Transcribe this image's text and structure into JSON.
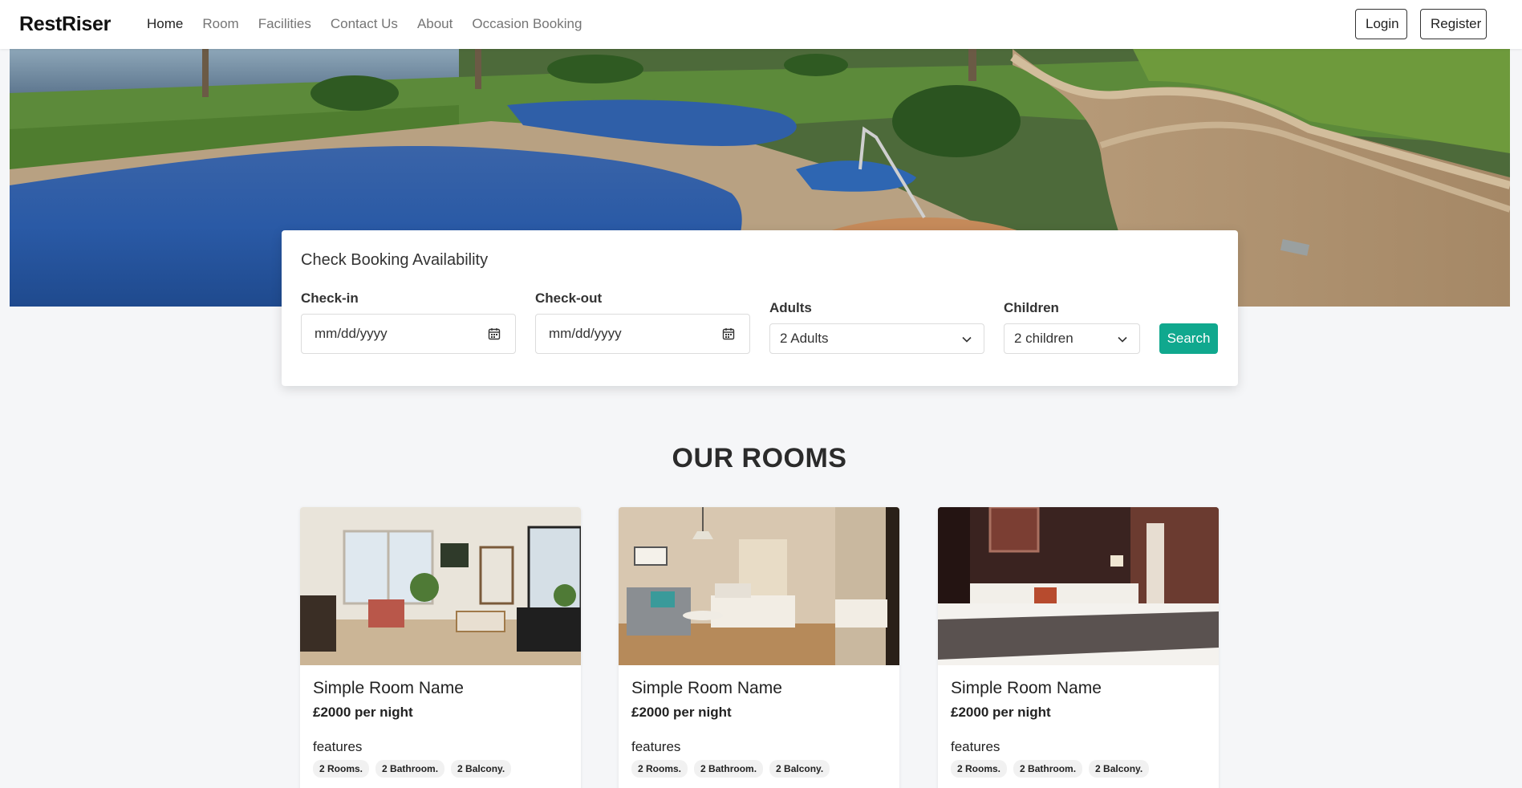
{
  "brand": "RestRiser",
  "nav": {
    "links": [
      "Home",
      "Room",
      "Facilities",
      "Contact Us",
      "About",
      "Occasion Booking"
    ],
    "login_label": "Login",
    "register_label": "Register"
  },
  "booking": {
    "title": "Check Booking Availability",
    "checkin_label": "Check-in",
    "checkin_placeholder": "mm/dd/yyyy",
    "checkout_label": "Check-out",
    "checkout_placeholder": "mm/dd/yyyy",
    "adults_label": "Adults",
    "adults_value": "2 Adults",
    "children_label": "Children",
    "children_value": "2 children",
    "search_label": "Search"
  },
  "rooms": {
    "title": "OUR ROOMS",
    "items": [
      {
        "name": "Simple Room Name",
        "price": "£2000 per night",
        "features_label": "features",
        "features": [
          "2 Rooms.",
          "2 Bathroom.",
          "2 Balcony."
        ]
      },
      {
        "name": "Simple Room Name",
        "price": "£2000 per night",
        "features_label": "features",
        "features": [
          "2 Rooms.",
          "2 Bathroom.",
          "2 Balcony."
        ]
      },
      {
        "name": "Simple Room Name",
        "price": "£2000 per night",
        "features_label": "features",
        "features": [
          "2 Rooms.",
          "2 Bathroom.",
          "2 Balcony."
        ]
      }
    ]
  },
  "colors": {
    "accent": "#10a88e",
    "page_bg": "#f5f6f8"
  }
}
